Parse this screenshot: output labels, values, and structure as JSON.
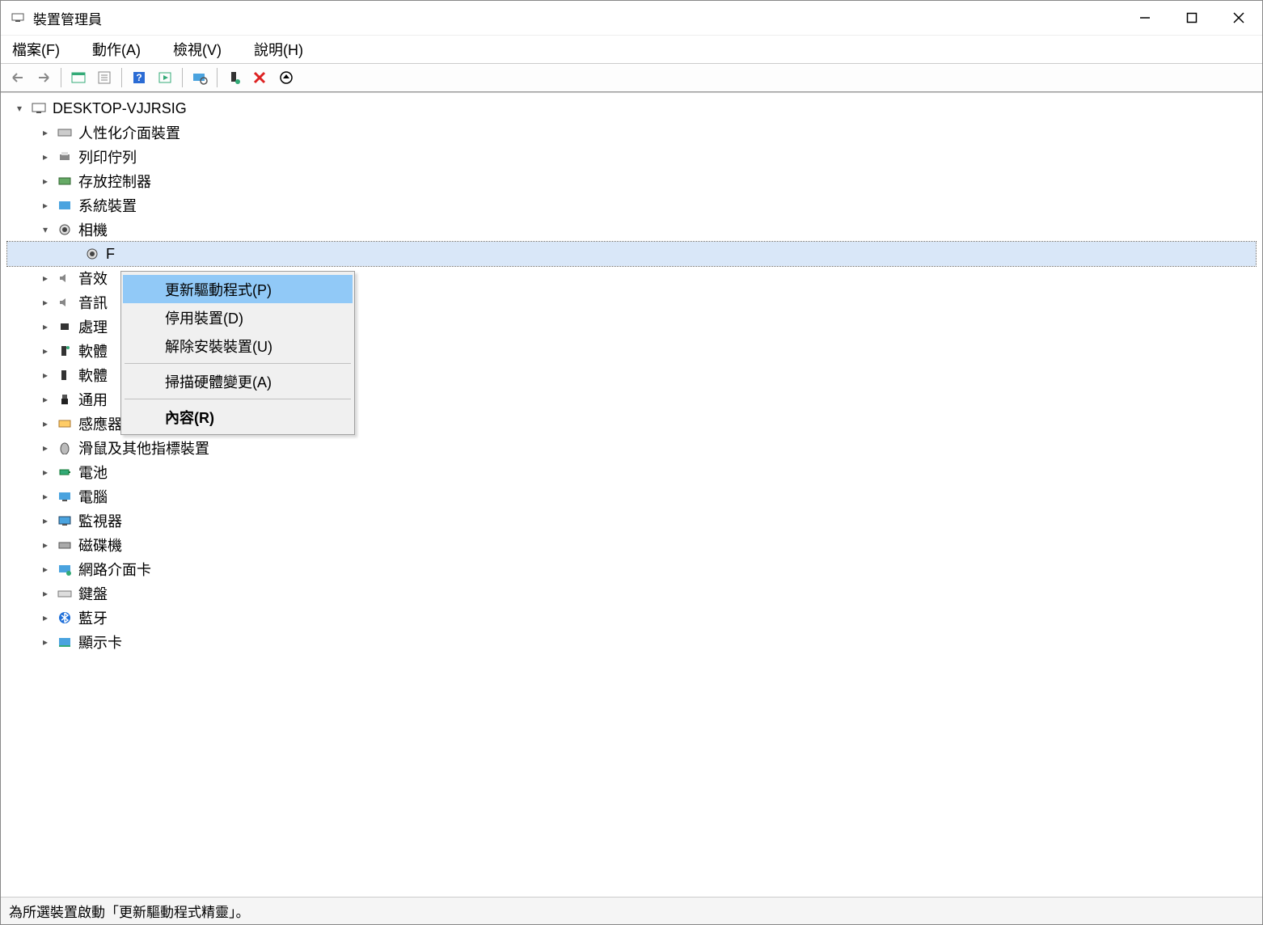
{
  "window": {
    "title": "裝置管理員"
  },
  "menu": {
    "file": "檔案(F)",
    "action": "動作(A)",
    "view": "檢視(V)",
    "help": "說明(H)"
  },
  "tree": {
    "root": "DESKTOP-VJJRSIG",
    "items": [
      "人性化介面裝置",
      "列印佇列",
      "存放控制器",
      "系統裝置",
      "相機",
      "音效",
      "音訊",
      "處理",
      "軟體",
      "軟體",
      "通用",
      "感應器",
      "滑鼠及其他指標裝置",
      "電池",
      "電腦",
      "監視器",
      "磁碟機",
      "網路介面卡",
      "鍵盤",
      "藍牙",
      "顯示卡"
    ],
    "camera_child_prefix": "F"
  },
  "context": {
    "update": "更新驅動程式(P)",
    "disable": "停用裝置(D)",
    "uninstall": "解除安裝裝置(U)",
    "scan": "掃描硬體變更(A)",
    "properties": "內容(R)"
  },
  "status": "為所選裝置啟動「更新驅動程式精靈」。"
}
